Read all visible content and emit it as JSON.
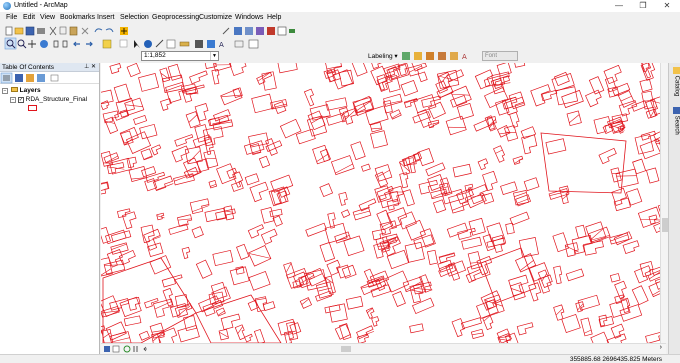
{
  "window": {
    "title": "Untitled - ArcMap",
    "minimize": "—",
    "maximize": "❐",
    "close": "✕"
  },
  "menu": [
    "File",
    "Edit",
    "View",
    "Bookmarks",
    "Insert",
    "Selection",
    "Geoprocessing",
    "Customize",
    "Windows",
    "Help"
  ],
  "scale": {
    "value": "1:1,852"
  },
  "labeling": {
    "label": "Labeling ▾",
    "font_placeholder": "Font"
  },
  "toc": {
    "title": "Table Of Contents",
    "pin": "⊥",
    "close": "✕",
    "root": "Layers",
    "layer": "RDA_Structure_Final"
  },
  "dock": {
    "catalog": "Catalog",
    "search": "Search"
  },
  "status": {
    "coordinates": "355885.68  2696435.825 Meters"
  },
  "colors": {
    "features": "#e0141c",
    "toc_header": "#dfe7f1",
    "map_bg": "#ffffff"
  }
}
